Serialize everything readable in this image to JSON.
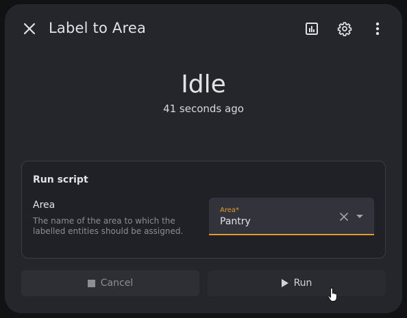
{
  "dialog": {
    "title": "Label to Area",
    "icons": {
      "close": "close-icon",
      "history": "chart-box-icon",
      "settings": "gear-icon",
      "more": "dots-vertical-icon"
    }
  },
  "state": {
    "value": "Idle",
    "last_changed": "41 seconds ago"
  },
  "run_card": {
    "title": "Run script",
    "field": {
      "name": "Area",
      "description": "The name of the area to which the labelled entities should be assigned.",
      "select_label": "Area",
      "required_marker": "*",
      "value": "Pantry"
    }
  },
  "actions": {
    "cancel_label": "Cancel",
    "run_label": "Run"
  },
  "colors": {
    "accent": "#e59a2e",
    "surface": "#25262c",
    "text": "#e3e3e6"
  }
}
